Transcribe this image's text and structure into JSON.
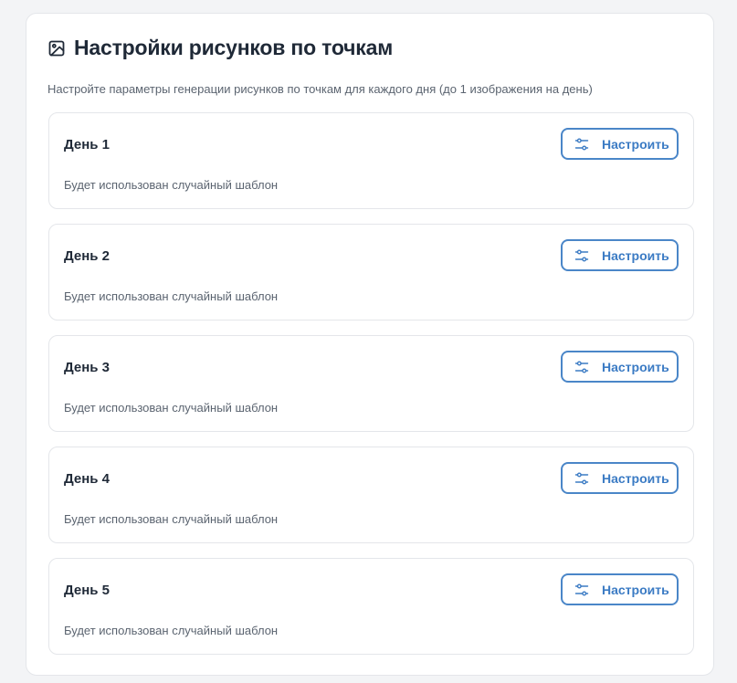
{
  "header": {
    "icon": "image-icon",
    "title": "Настройки рисунков по точкам",
    "subtitle": "Настройте параметры генерации рисунков по точкам для каждого дня (до 1 изображения на день)"
  },
  "days": [
    {
      "title": "День 1",
      "description": "Будет использован случайный шаблон",
      "button_label": "Настроить",
      "button_icon": "sliders-icon"
    },
    {
      "title": "День 2",
      "description": "Будет использован случайный шаблон",
      "button_label": "Настроить",
      "button_icon": "sliders-icon"
    },
    {
      "title": "День 3",
      "description": "Будет использован случайный шаблон",
      "button_label": "Настроить",
      "button_icon": "sliders-icon"
    },
    {
      "title": "День 4",
      "description": "Будет использован случайный шаблон",
      "button_label": "Настроить",
      "button_icon": "sliders-icon"
    },
    {
      "title": "День 5",
      "description": "Будет использован случайный шаблон",
      "button_label": "Настроить",
      "button_icon": "sliders-icon"
    }
  ],
  "colors": {
    "accent": "#3b7bc4",
    "button_border": "#4a86c8",
    "title_text": "#1f2937",
    "muted_text": "#5b6470",
    "page_background": "#f3f4f6",
    "card_border": "#e4e6ea"
  }
}
